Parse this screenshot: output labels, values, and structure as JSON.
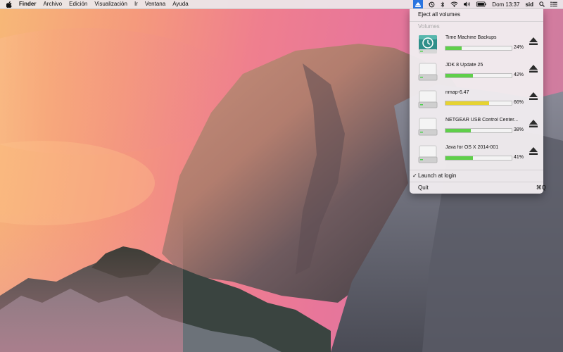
{
  "menubar": {
    "apple_icon": "apple-logo-icon",
    "app_name": "Finder",
    "menus": [
      "Archivo",
      "Edición",
      "Visualización",
      "Ir",
      "Ventana",
      "Ayuda"
    ],
    "status_icons": [
      "eject-icon",
      "time-machine-icon",
      "bluetooth-icon",
      "wifi-icon",
      "volume-icon",
      "battery-icon"
    ],
    "clock": "Dom 13:37",
    "user": "sid",
    "right_icons": [
      "spotlight-icon",
      "notification-center-icon"
    ]
  },
  "panel": {
    "eject_all_label": "Eject all volumes",
    "section_label": "Volumes",
    "volumes": [
      {
        "name": "Time Machine Backups",
        "percent": "24%",
        "fill": 0.24,
        "color": "#5fcf4a",
        "icon": "time-machine-drive-icon"
      },
      {
        "name": "JDK 8 Update 25",
        "percent": "42%",
        "fill": 0.42,
        "color": "#5fcf4a",
        "icon": "disk-image-icon"
      },
      {
        "name": "nmap-6.47",
        "percent": "66%",
        "fill": 0.66,
        "color": "#e6d332",
        "icon": "disk-image-icon"
      },
      {
        "name": "NETGEAR USB Control Center...",
        "percent": "38%",
        "fill": 0.38,
        "color": "#5fcf4a",
        "icon": "disk-image-icon"
      },
      {
        "name": "Java for OS X 2014-001",
        "percent": "41%",
        "fill": 0.41,
        "color": "#5fcf4a",
        "icon": "disk-image-icon"
      }
    ],
    "launch_at_login_label": "Launch at login",
    "launch_at_login_checked": true,
    "quit_label": "Quit",
    "quit_shortcut": "⌘Q"
  }
}
